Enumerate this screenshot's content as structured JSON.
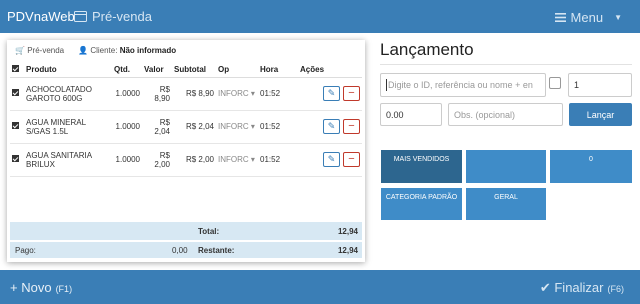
{
  "navbar": {
    "brand": "PDVnaWeb",
    "link_label": "Pré-venda",
    "menu_label": "Menu"
  },
  "receipt": {
    "type_label": "Pré-venda",
    "client_label": "Cliente:",
    "client_value": "Não informado",
    "columns": [
      "Produto",
      "Qtd.",
      "Valor",
      "Subtotal",
      "Op",
      "Hora",
      "Ações"
    ],
    "rows": [
      {
        "produto": "ACHOCOLATADO GAROTO 600G",
        "qtd": "1.0000",
        "valor": "R$ 8,90",
        "subtotal": "R$ 8,90",
        "op": "INFORC",
        "hora": "01:52"
      },
      {
        "produto": "AGUA MINERAL S/GAS 1.5L",
        "qtd": "1.0000",
        "valor": "R$ 2,04",
        "subtotal": "R$ 2,04",
        "op": "INFORC",
        "hora": "01:52"
      },
      {
        "produto": "AGUA SANITARIA BRILUX",
        "qtd": "1.0000",
        "valor": "R$ 2,00",
        "subtotal": "R$ 2,00",
        "op": "INFORC",
        "hora": "01:52"
      }
    ],
    "total_label": "Total:",
    "total_value": "12,94",
    "pago_label": "Pago:",
    "pago_value": "0,00",
    "restante_label": "Restante:",
    "restante_value": "12,94"
  },
  "panel": {
    "title": "Lançamento",
    "search_placeholder": "Digite o ID, referência ou nome + en",
    "qty_value": "1",
    "value_value": "0.00",
    "obs_placeholder": "Obs. (opcional)",
    "lancar_label": "Lançar",
    "tiles": [
      "MAIS VENDIDOS",
      "",
      "0",
      "CATEGORIA PADRÃO",
      "GERAL"
    ]
  },
  "bottombar": {
    "new_label": "+ Novo",
    "new_shortcut": "(F1)",
    "finish_label": "✔ Finalizar",
    "finish_shortcut": "(F6)"
  },
  "colors": {
    "primary": "#3a7eb6",
    "tile": "#3f8cc8",
    "tile_active": "#2d668f",
    "danger": "#c0392b",
    "totals_bg": "#d7e8f3"
  }
}
